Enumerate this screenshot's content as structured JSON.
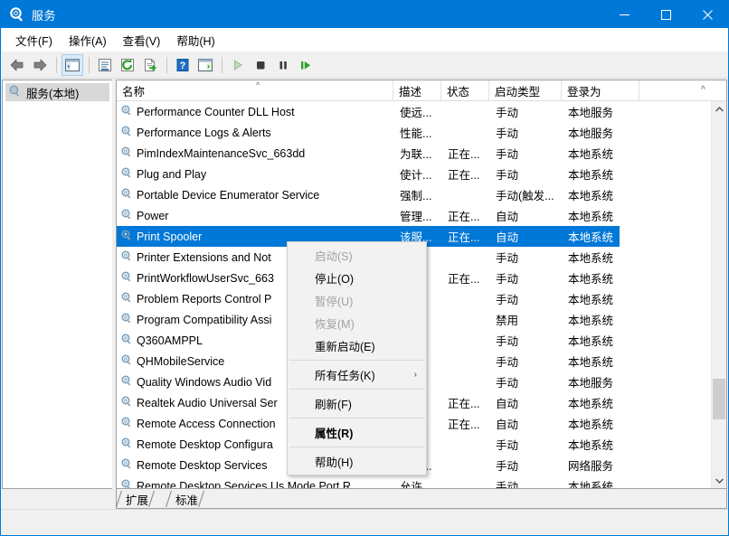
{
  "window": {
    "title": "服务",
    "icon": "services-gear-icon",
    "accent_color": "#0078d7",
    "controls": {
      "minimize": "minimize-icon",
      "maximize": "maximize-icon",
      "close": "close-icon"
    }
  },
  "menubar": {
    "items": [
      {
        "label": "文件(F)",
        "name": "menu-file"
      },
      {
        "label": "操作(A)",
        "name": "menu-action"
      },
      {
        "label": "查看(V)",
        "name": "menu-view"
      },
      {
        "label": "帮助(H)",
        "name": "menu-help"
      }
    ]
  },
  "toolbar": {
    "buttons": [
      {
        "name": "back-button",
        "icon": "arrow-left-icon"
      },
      {
        "name": "forward-button",
        "icon": "arrow-right-icon"
      },
      {
        "name": "show-hide-console-tree-button",
        "icon": "console-tree-icon",
        "active": true
      },
      {
        "name": "properties-button",
        "icon": "properties-icon"
      },
      {
        "name": "refresh-button",
        "icon": "refresh-icon"
      },
      {
        "name": "export-list-button",
        "icon": "export-list-icon"
      },
      {
        "name": "help-button",
        "icon": "question-mark-icon"
      },
      {
        "name": "show-action-pane-button",
        "icon": "action-pane-icon"
      },
      {
        "name": "start-service-button",
        "icon": "play-icon"
      },
      {
        "name": "stop-service-button",
        "icon": "stop-icon"
      },
      {
        "name": "pause-service-button",
        "icon": "pause-icon"
      },
      {
        "name": "restart-service-button",
        "icon": "restart-icon"
      }
    ]
  },
  "tree": {
    "root": {
      "label": "服务(本地)",
      "icon": "services-gear-icon",
      "selected": true
    }
  },
  "list": {
    "columns": [
      {
        "key": "name",
        "label": "名称",
        "sorted": "asc"
      },
      {
        "key": "description",
        "label": "描述"
      },
      {
        "key": "state",
        "label": "状态"
      },
      {
        "key": "startup",
        "label": "启动类型"
      },
      {
        "key": "logon",
        "label": "登录为"
      }
    ],
    "rows": [
      {
        "name": "Performance Counter DLL Host",
        "description": "使远...",
        "state": "",
        "startup": "手动",
        "logon": "本地服务",
        "selected": false
      },
      {
        "name": "Performance Logs & Alerts",
        "description": "性能...",
        "state": "",
        "startup": "手动",
        "logon": "本地服务",
        "selected": false
      },
      {
        "name": "PimIndexMaintenanceSvc_663dd",
        "description": "为联...",
        "state": "正在...",
        "startup": "手动",
        "logon": "本地系统",
        "selected": false
      },
      {
        "name": "Plug and Play",
        "description": "使计...",
        "state": "正在...",
        "startup": "手动",
        "logon": "本地系统",
        "selected": false
      },
      {
        "name": "Portable Device Enumerator Service",
        "description": "强制...",
        "state": "",
        "startup": "手动(触发...",
        "logon": "本地系统",
        "selected": false
      },
      {
        "name": "Power",
        "description": "管理...",
        "state": "正在...",
        "startup": "自动",
        "logon": "本地系统",
        "selected": false
      },
      {
        "name": "Print Spooler",
        "description": "该服...",
        "state": "正在...",
        "startup": "自动",
        "logon": "本地系统",
        "selected": true
      },
      {
        "name": "Printer Extensions and Not",
        "description": "...",
        "state": "",
        "startup": "手动",
        "logon": "本地系统",
        "selected": false
      },
      {
        "name": "PrintWorkflowUserSvc_663",
        "description": "...",
        "state": "正在...",
        "startup": "手动",
        "logon": "本地系统",
        "selected": false
      },
      {
        "name": "Problem Reports Control P",
        "description": "...",
        "state": "",
        "startup": "手动",
        "logon": "本地系统",
        "selected": false
      },
      {
        "name": "Program Compatibility Assi",
        "description": "...",
        "state": "",
        "startup": "禁用",
        "logon": "本地系统",
        "selected": false
      },
      {
        "name": "Q360AMPPL",
        "description": "",
        "state": "",
        "startup": "手动",
        "logon": "本地系统",
        "selected": false
      },
      {
        "name": "QHMobileService",
        "description": "",
        "state": "",
        "startup": "手动",
        "logon": "本地系统",
        "selected": false
      },
      {
        "name": "Quality Windows Audio Vid",
        "description": "...",
        "state": "",
        "startup": "手动",
        "logon": "本地服务",
        "selected": false
      },
      {
        "name": "Realtek Audio Universal Ser",
        "description": "...",
        "state": "正在...",
        "startup": "自动",
        "logon": "本地系统",
        "selected": false
      },
      {
        "name": "Remote Access Connection",
        "description": "...",
        "state": "正在...",
        "startup": "自动",
        "logon": "本地系统",
        "selected": false
      },
      {
        "name": "Remote Desktop Configura",
        "description": "...",
        "state": "",
        "startup": "手动",
        "logon": "本地系统",
        "selected": false
      },
      {
        "name": "Remote Desktop Services",
        "description": "允许...",
        "state": "",
        "startup": "手动",
        "logon": "网络服务",
        "selected": false
      },
      {
        "name": "Remote Desktop Services Us Mode Port R",
        "description": "允许...",
        "state": "",
        "startup": "手动",
        "logon": "本地系统",
        "selected": false
      }
    ]
  },
  "scrollbar": {
    "up_arrow": "chevron-up-icon",
    "down_arrow": "chevron-down-icon"
  },
  "tabs": [
    {
      "label": "扩展",
      "name": "tab-extended",
      "active": false
    },
    {
      "label": "标准",
      "name": "tab-standard",
      "active": true
    }
  ],
  "context_menu": {
    "items": [
      {
        "label": "启动(S)",
        "name": "ctx-start",
        "disabled": true,
        "bold": false,
        "submenu": false
      },
      {
        "label": "停止(O)",
        "name": "ctx-stop",
        "disabled": false,
        "bold": false,
        "submenu": false
      },
      {
        "label": "暂停(U)",
        "name": "ctx-pause",
        "disabled": true,
        "bold": false,
        "submenu": false
      },
      {
        "label": "恢复(M)",
        "name": "ctx-resume",
        "disabled": true,
        "bold": false,
        "submenu": false
      },
      {
        "label": "重新启动(E)",
        "name": "ctx-restart",
        "disabled": false,
        "bold": false,
        "submenu": false
      },
      {
        "separator": true
      },
      {
        "label": "所有任务(K)",
        "name": "ctx-all-tasks",
        "disabled": false,
        "bold": false,
        "submenu": true
      },
      {
        "separator": true
      },
      {
        "label": "刷新(F)",
        "name": "ctx-refresh",
        "disabled": false,
        "bold": false,
        "submenu": false
      },
      {
        "separator": true
      },
      {
        "label": "属性(R)",
        "name": "ctx-properties",
        "disabled": false,
        "bold": true,
        "submenu": false
      },
      {
        "separator": true
      },
      {
        "label": "帮助(H)",
        "name": "ctx-help",
        "disabled": false,
        "bold": false,
        "submenu": false
      }
    ],
    "submenu_arrow": "chevron-right-icon"
  }
}
